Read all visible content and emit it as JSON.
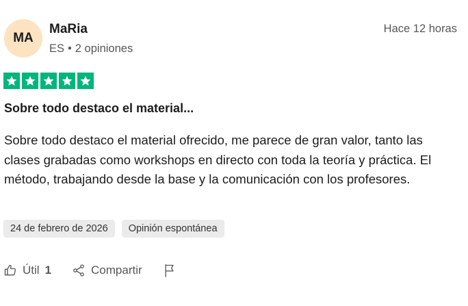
{
  "review": {
    "avatar_initials": "MA",
    "avatar_color": "#fde3c1",
    "reviewer_name": "MaRia",
    "country": "ES",
    "separator": "•",
    "reviews_count": "2 opiniones",
    "time_ago": "Hace 12 horas",
    "rating": 5,
    "star_color": "#00b67a",
    "title": "Sobre todo destaco el material...",
    "text": "Sobre todo destaco el material ofrecido, me parece de gran valor, tanto las clases grabadas como workshops en directo con toda la teoría y práctica. El método, trabajando desde la base y la comunicación con los profesores.",
    "date_tag": "24 de febrero de 2026",
    "type_tag": "Opinión espontánea"
  },
  "actions": {
    "useful_label": "Útil",
    "useful_count": "1",
    "useful_icon": "thumbs-up-icon",
    "share_label": "Compartir",
    "share_icon": "share-icon",
    "report_icon": "flag-icon"
  }
}
